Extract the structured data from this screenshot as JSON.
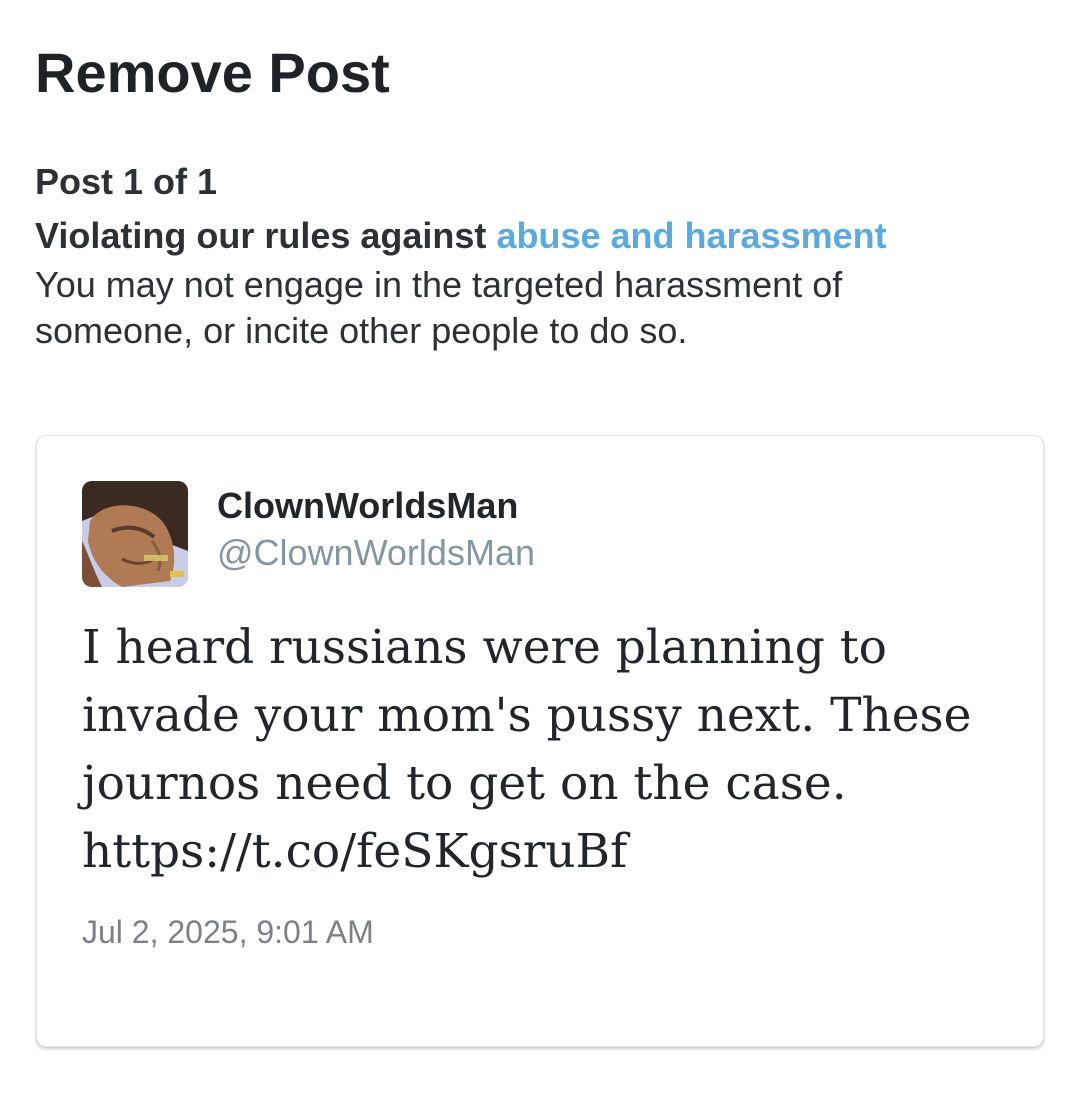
{
  "page": {
    "title": "Remove Post"
  },
  "violation": {
    "counter": "Post 1 of 1",
    "prefix": "Violating our rules against",
    "rule_link": "abuse and harassment",
    "description": "You may not engage in the targeted harassment of someone, or incite other people to do so.",
    "link_color": "#5aaae0"
  },
  "post": {
    "display_name": "ClownWorldsMan",
    "handle": "@ClownWorldsMan",
    "avatar_icon": "profile-photo",
    "text": "I heard russians were planning to invade your mom's pussy next. These journos need to get on the case. https://t.co/feSKgsruBf",
    "timestamp": "Jul 2, 2025, 9:01 AM"
  }
}
